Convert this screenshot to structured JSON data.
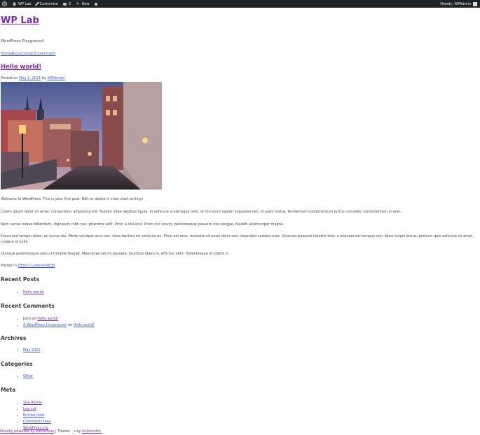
{
  "adminbar": {
    "site_name": "WP Lab",
    "customize": "Customize",
    "comments_count": "0",
    "new_label": "New",
    "howdy": "Howdy, WPAdmin"
  },
  "site": {
    "title": "WP Lab",
    "description": "WordPress Playground"
  },
  "nav": [
    "Home",
    "About",
    "Contact",
    "Cover",
    "Invert"
  ],
  "post": {
    "title": "Hello world!",
    "posted_on": "Posted on",
    "date": "May 1, 2021",
    "by": "by",
    "author": "WPVendor",
    "paragraphs": [
      "Welcome to WordPress. This is your first post. Edit or delete it, then start writing!",
      "Lorem ipsum dolor sit amet, consectetur adipiscing elit. Nullam vitae dapibus ligula. In vehicula scelerisque sem, et tincidunt sapien vulputate nec. In justo metus, fermentum condimentum luctus convallis, condimentum in erat.",
      "Nam varius neque bibendum, dignissim nibh nec, pharetra velit. Proin a nisl erat. Proin nisl ipsum, pellentesque posuere nisl congue, blandit ullamcorper magna.",
      "Fusce sed tempor diam, ac luctus dui. Morbi volutpat arcu nisl, vitae facilisis mi vehicula eu. Proin est eros, molestie sit amet dolor sed, imperdiet sodales eros. Vivamus posuere lobortis felis, a aliquam est tempus non. Nunc turpis lectus, pretium quis vehicula sit amet, congue id nulla.",
      "Quisque pellentesque odio ut fringilla feugiat. Maecenas vel mi posuere, faucibus libero in, efficitur velit. Pellentesque id mattis n"
    ],
    "posted_in": "Posted in",
    "category": "Other",
    "comments_link": "1 Comment",
    "edit": "Edit"
  },
  "widgets": {
    "recent_posts": {
      "title": "Recent Posts",
      "items": [
        "Hello world!"
      ]
    },
    "recent_comments": {
      "title": "Recent Comments",
      "items": [
        {
          "author": "John",
          "on": "on",
          "post": "Hello world!"
        },
        {
          "author": "A WordPress Commenter",
          "on": "on",
          "post": "Hello world!"
        }
      ]
    },
    "archives": {
      "title": "Archives",
      "items": [
        "May 2021"
      ]
    },
    "categories": {
      "title": "Categories",
      "items": [
        "Other"
      ]
    },
    "meta": {
      "title": "Meta",
      "items": [
        "Site Admin",
        "Log out",
        "Entries feed",
        "Comments feed",
        "WordPress.org"
      ]
    }
  },
  "footer": {
    "powered": "Proudly powered by WordPress",
    "sep": "| Theme: _s by",
    "theme_author": "Automattic."
  }
}
